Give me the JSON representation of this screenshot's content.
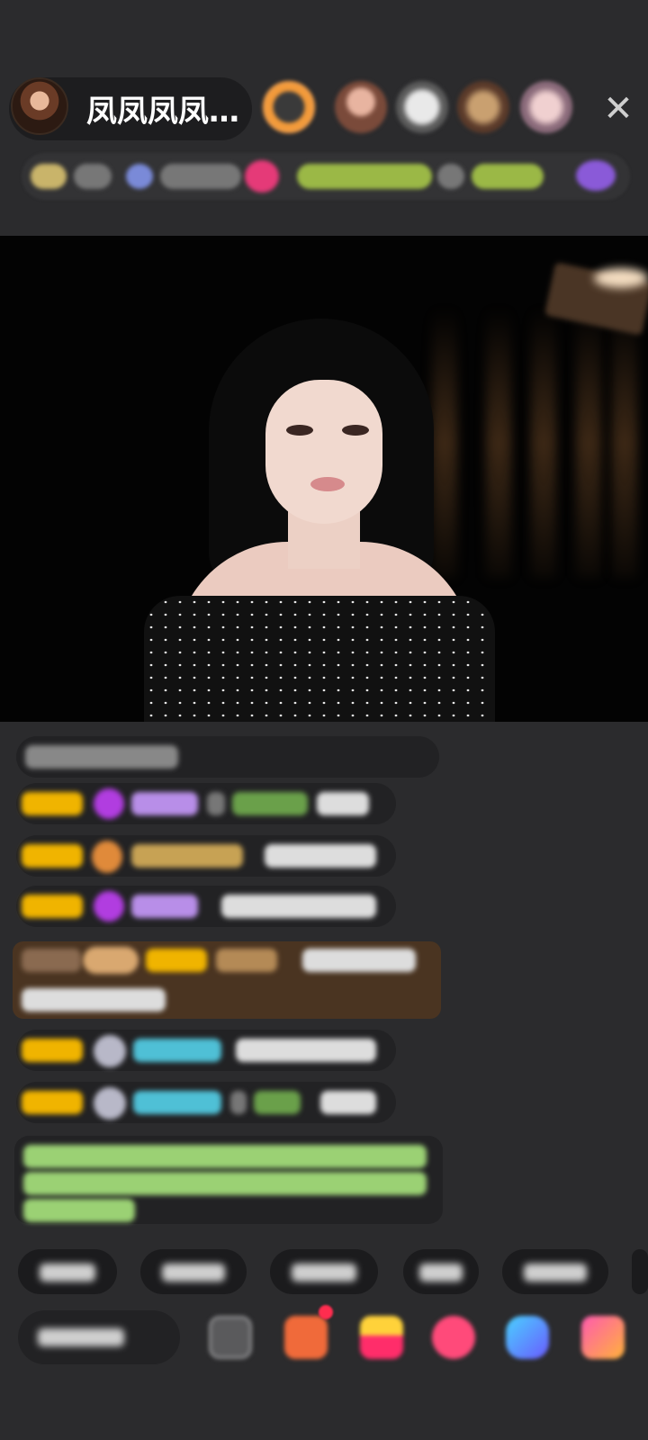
{
  "header": {
    "host_name": "凤凤凤凤…",
    "close_icon": "close-icon",
    "viewer_avatars": [
      "viewer-avatar-1",
      "viewer-avatar-2",
      "viewer-avatar-3",
      "viewer-avatar-4",
      "viewer-avatar-5"
    ]
  },
  "colors": {
    "background": "#2b2b2d",
    "chat_pill": "#222224",
    "level_badge": "#f0b400",
    "gift_row": "#4a3421",
    "notice_text": "#9bd174",
    "cyan_name": "#4fc0d6",
    "purple_name": "#b88ee8"
  },
  "icons": {
    "chat_input_icon": "comment-icon",
    "emoji": "emoji-icon",
    "gift_box": "gift-box-icon",
    "gift_bag": "gift-bag-icon",
    "heart": "heart-icon",
    "game": "game-controller-icon",
    "more": "grid-more-icon"
  }
}
